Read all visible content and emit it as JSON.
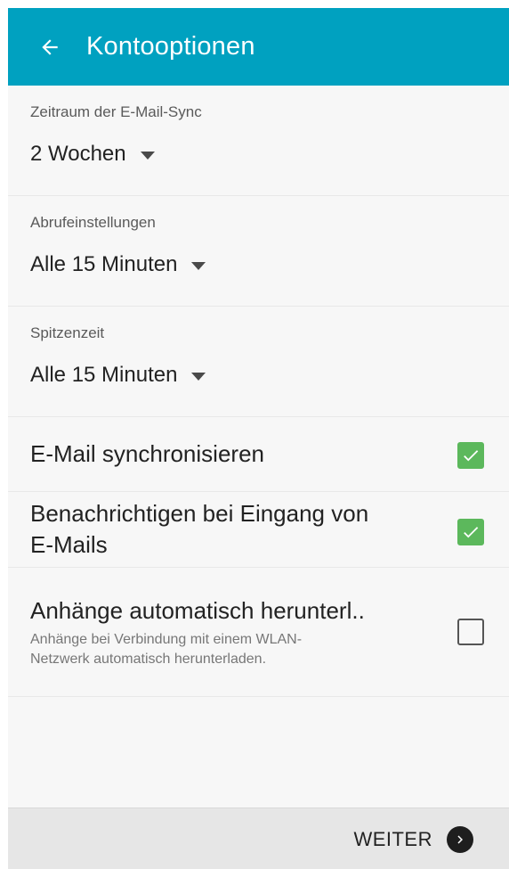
{
  "app_bar": {
    "title": "Kontooptionen",
    "back_icon": "arrow-left-icon",
    "color": "#00a1c0"
  },
  "settings": {
    "sync_period": {
      "label": "Zeitraum der E-Mail-Sync",
      "value": "2 Wochen"
    },
    "fetch_settings": {
      "label": "Abrufeinstellungen",
      "value": "Alle 15 Minuten"
    },
    "peak_time": {
      "label": "Spitzenzeit",
      "value": "Alle 15 Minuten"
    },
    "sync_email": {
      "title": "E-Mail synchronisieren",
      "checked": true
    },
    "notify": {
      "title_line1": "Benachrichtigen bei Eingang von",
      "title_line2": "E-Mails",
      "checked": true
    },
    "auto_download": {
      "title": "Anhänge automatisch herunterl..",
      "subtitle_line1": "Anhänge bei Verbindung mit einem WLAN-",
      "subtitle_line2": "Netzwerk automatisch herunterladen.",
      "checked": false
    }
  },
  "footer": {
    "next_label": "WEITER",
    "next_icon": "chevron-right-circle-icon"
  },
  "colors": {
    "checkbox_checked": "#5cb85c",
    "footer_bg": "#e6e6e6"
  }
}
